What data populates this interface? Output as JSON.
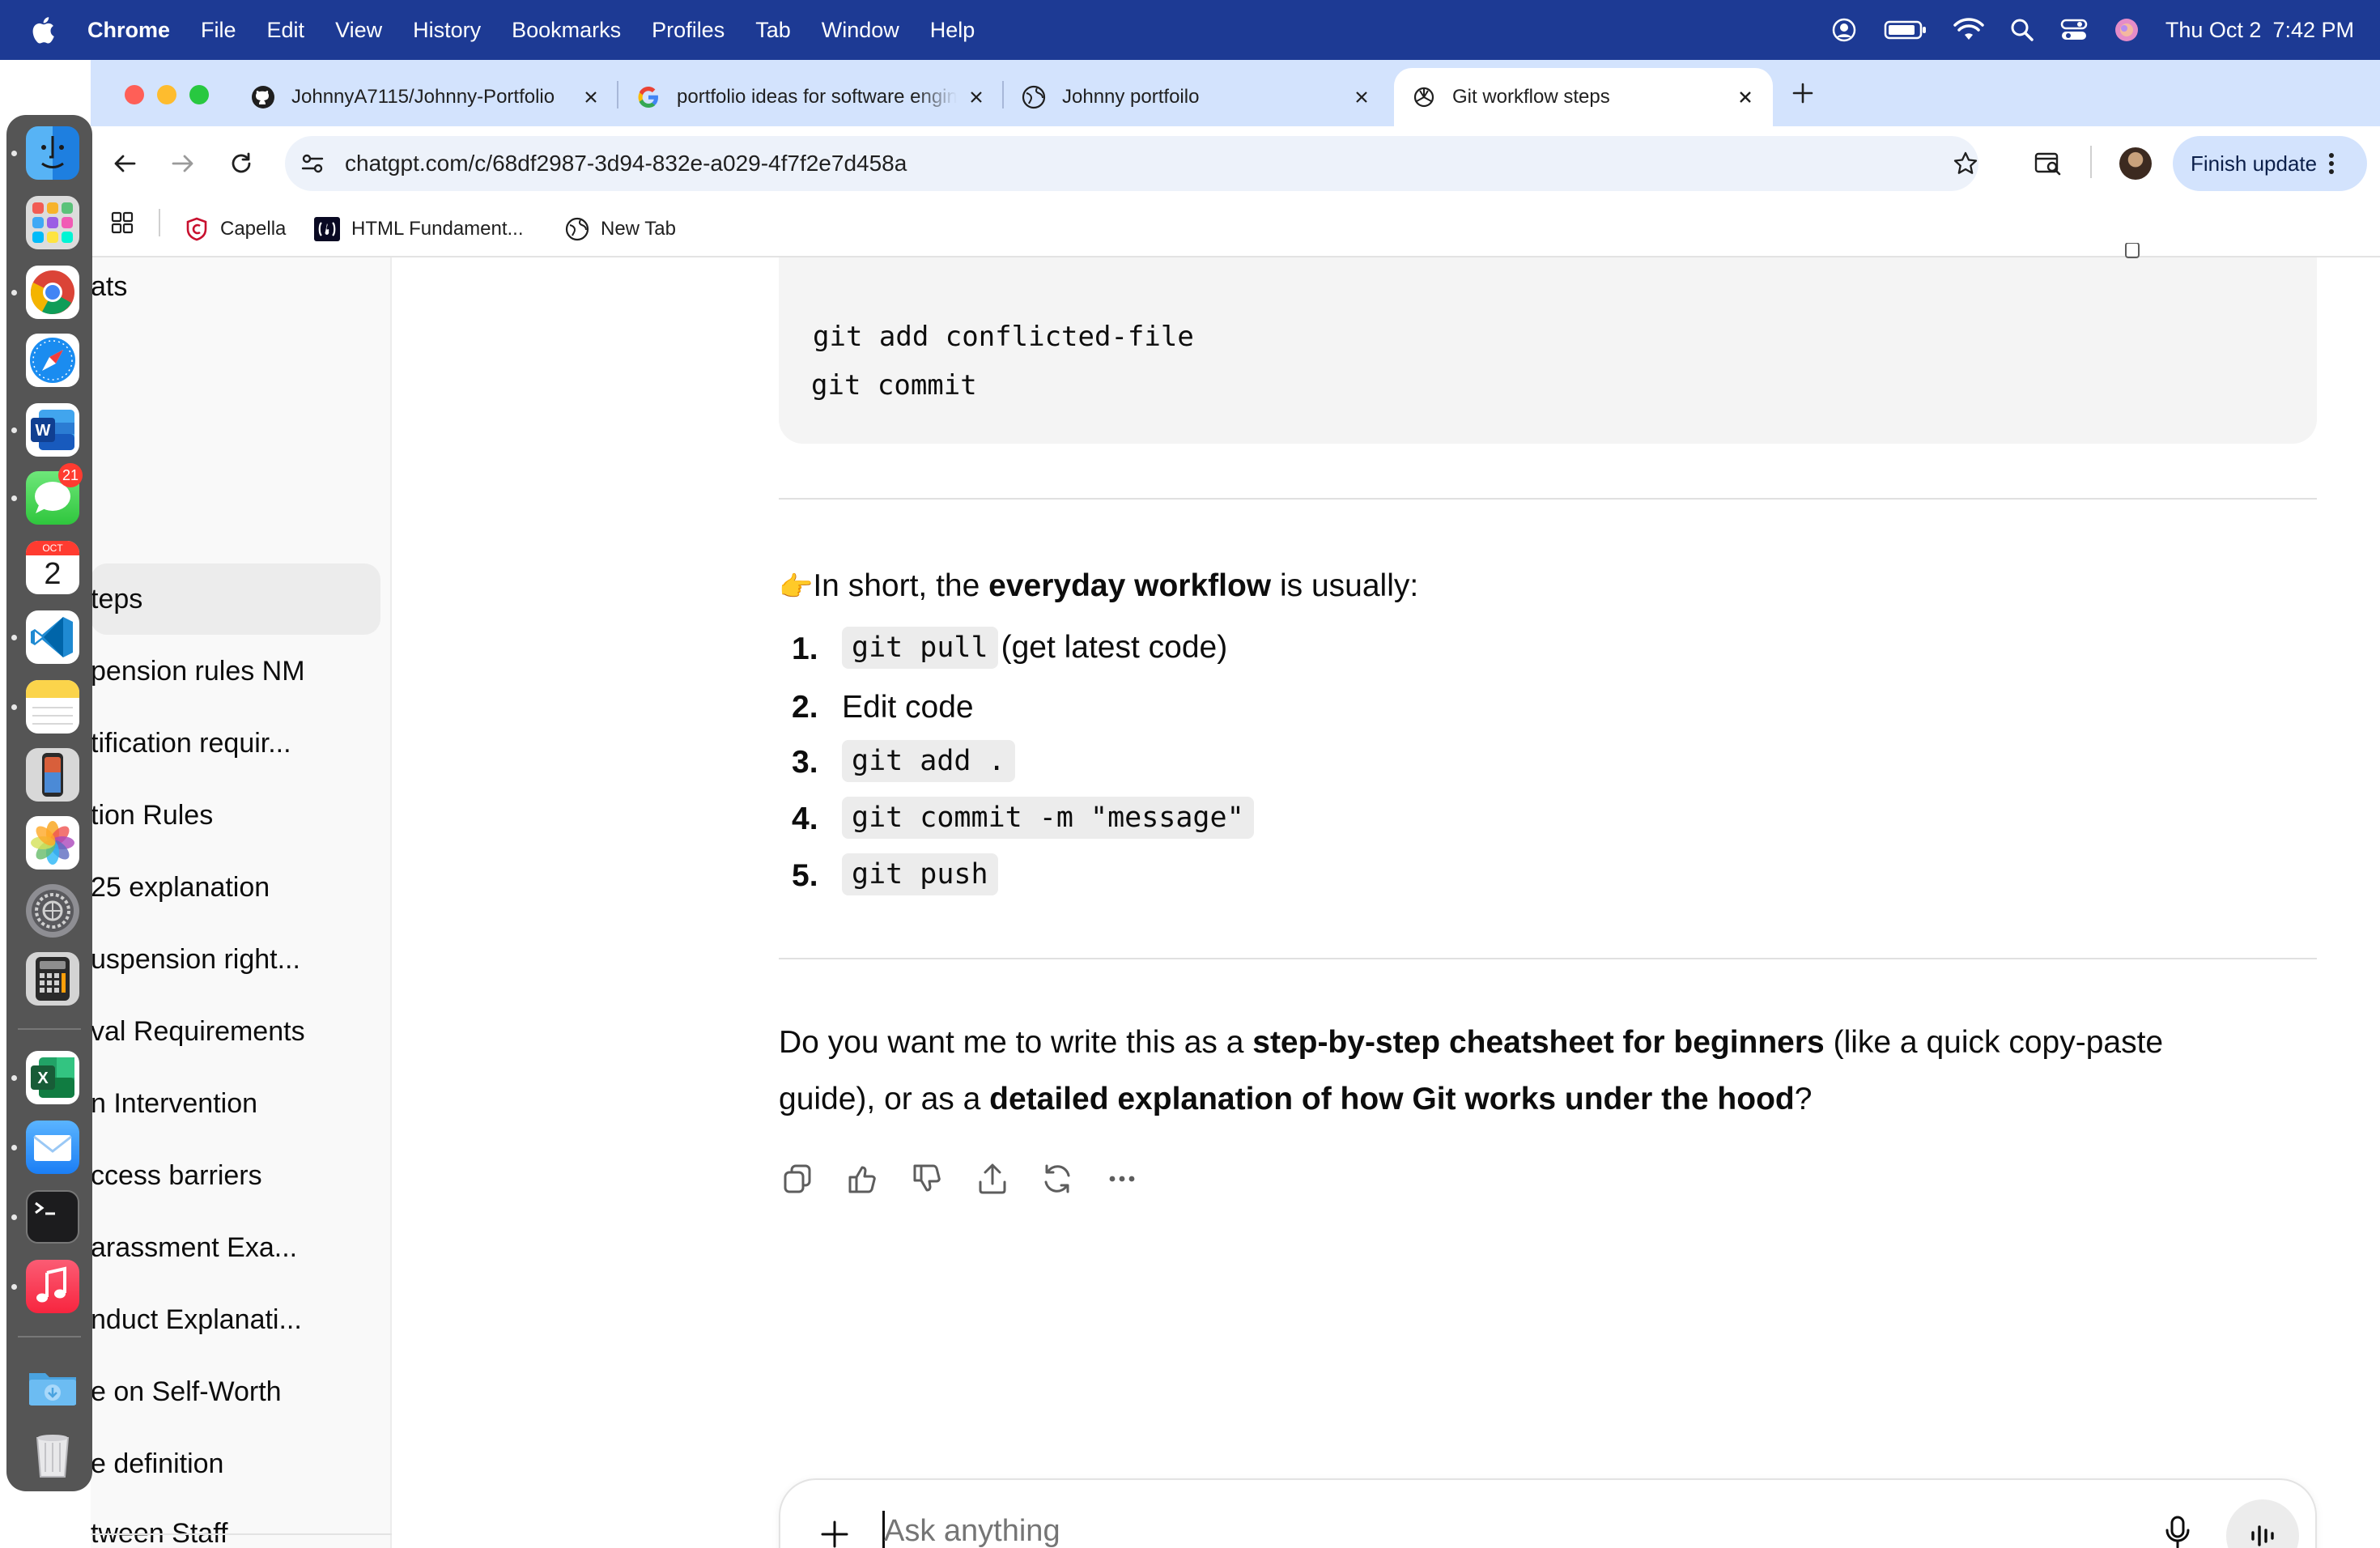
{
  "menubar": {
    "app": "Chrome",
    "items": [
      "File",
      "Edit",
      "View",
      "History",
      "Bookmarks",
      "Profiles",
      "Tab",
      "Window",
      "Help"
    ],
    "date": "Thu Oct 2",
    "time": "7:42 PM"
  },
  "tabs": [
    {
      "title": "JohnnyA7115/Johnny-Portfolio",
      "icon": "github-icon"
    },
    {
      "title": "portfolio ideas for software engineer",
      "icon": "google-icon"
    },
    {
      "title": "Johnny portfoilo",
      "icon": "globe-icon"
    },
    {
      "title": "Git workflow steps",
      "icon": "openai-icon",
      "active": true
    }
  ],
  "omnibox": {
    "url": "chatgpt.com/c/68df2987-3d94-832e-a029-4f7f2e7d458a"
  },
  "toolbar": {
    "finish_update": "Finish update"
  },
  "bookmarks": [
    {
      "label": "Capella",
      "icon": "capella-icon"
    },
    {
      "label": "HTML Fundament...",
      "icon": "freecodecamp-icon"
    },
    {
      "label": "New Tab",
      "icon": "globe-icon"
    }
  ],
  "sidebar": {
    "items": [
      {
        "label": "ats"
      },
      {
        "label": "teps",
        "active": true
      },
      {
        "label": "pension rules NM"
      },
      {
        "label": "tification requir..."
      },
      {
        "label": "tion Rules"
      },
      {
        "label": "25 explanation"
      },
      {
        "label": "uspension right..."
      },
      {
        "label": "val Requirements"
      },
      {
        "label": "n Intervention"
      },
      {
        "label": "ccess barriers"
      },
      {
        "label": "arassment Exa..."
      },
      {
        "label": "nduct Explanati..."
      },
      {
        "label": "e on Self-Worth"
      },
      {
        "label": "e definition"
      },
      {
        "label": "tween Staff"
      }
    ]
  },
  "dock": {
    "items": [
      "Finder",
      "Launchpad",
      "Google Chrome",
      "Safari",
      "Microsoft Word",
      "Messages",
      "Calendar",
      "Visual Studio Code",
      "Notes",
      "iPhone Mirroring",
      "Photos",
      "System Settings",
      "Calculator",
      "Microsoft Excel",
      "Mail",
      "Terminal",
      "Music",
      "Downloads",
      "Trash"
    ],
    "messages_badge": "21",
    "calendar_month": "OCT",
    "calendar_day": "2"
  },
  "chat": {
    "code_lines": [
      "git add conflicted-file",
      "git commit"
    ],
    "summary": {
      "emoji": "👉",
      "prefix": "In short, the ",
      "bold": "everyday workflow",
      "suffix": " is usually:"
    },
    "steps": [
      {
        "num": "1.",
        "code": "git pull",
        "text": " (get latest code)"
      },
      {
        "num": "2.",
        "code": "",
        "text": "Edit code"
      },
      {
        "num": "3.",
        "code": "git add .",
        "text": ""
      },
      {
        "num": "4.",
        "code": "git commit -m \"message\"",
        "text": ""
      },
      {
        "num": "5.",
        "code": "git push",
        "text": ""
      }
    ],
    "question": {
      "p1": "Do you want me to write this as a ",
      "b1": "step-by-step cheatsheet for beginners",
      "p2": " (like a quick copy-paste",
      "p3": "guide), or as a ",
      "b2": "detailed explanation of how Git works under the hood",
      "p4": "?"
    },
    "actions": [
      "copy-icon",
      "thumbs-up-icon",
      "thumbs-down-icon",
      "share-icon",
      "regenerate-icon",
      "more-icon"
    ]
  },
  "composer": {
    "placeholder": "Ask anything"
  }
}
